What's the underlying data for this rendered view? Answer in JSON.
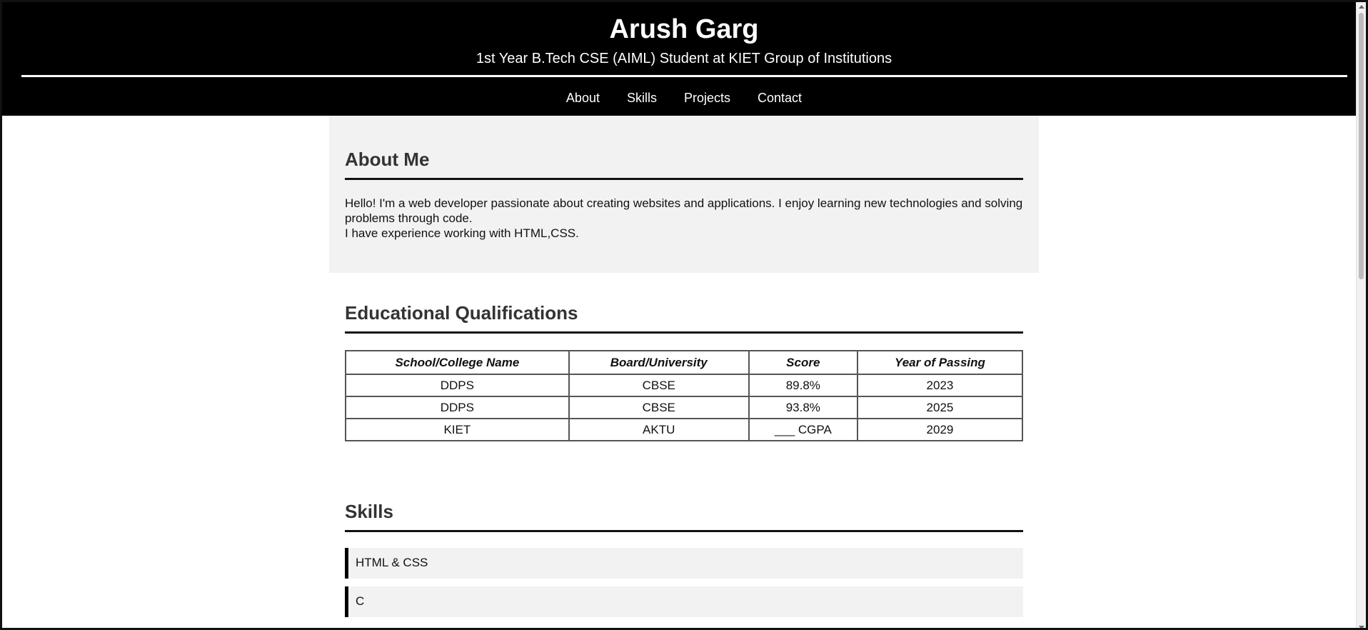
{
  "header": {
    "name": "Arush Garg",
    "subtitle": "1st Year B.Tech CSE (AIML) Student at KIET Group of Institutions"
  },
  "nav": {
    "items": [
      {
        "label": "About"
      },
      {
        "label": "Skills"
      },
      {
        "label": "Projects"
      },
      {
        "label": "Contact"
      }
    ]
  },
  "about": {
    "heading": "About Me",
    "line1": "Hello! I'm a web developer passionate about creating websites and applications. I enjoy learning new technologies and solving problems through code.",
    "line2": "I have experience working with HTML,CSS."
  },
  "education": {
    "heading": "Educational Qualifications",
    "columns": [
      "School/College Name",
      "Board/University",
      "Score",
      "Year of Passing"
    ],
    "rows": [
      [
        "DDPS",
        "CBSE",
        "89.8%",
        "2023"
      ],
      [
        "DDPS",
        "CBSE",
        "93.8%",
        "2025"
      ],
      [
        "KIET",
        "AKTU",
        "___ CGPA",
        "2029"
      ]
    ]
  },
  "skills": {
    "heading": "Skills",
    "items": [
      "HTML & CSS",
      "C"
    ]
  }
}
